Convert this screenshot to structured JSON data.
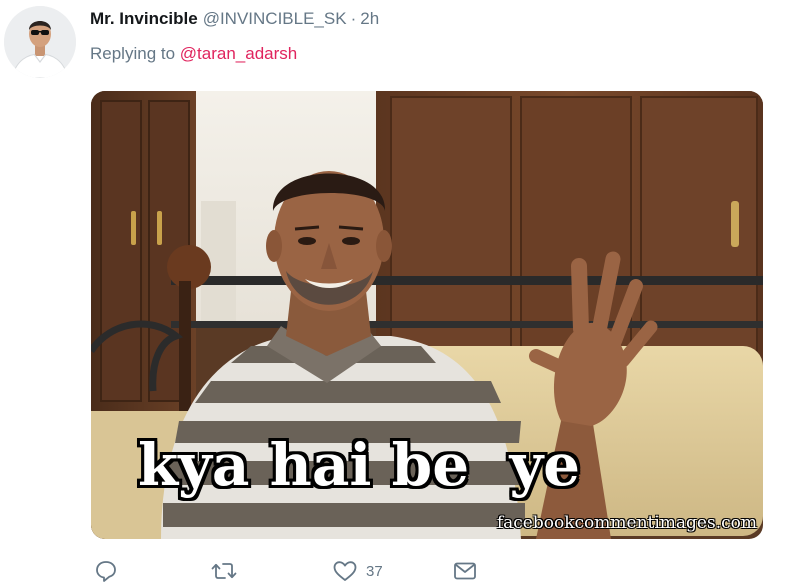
{
  "tweet": {
    "author": {
      "display_name": "Mr. Invincible",
      "handle": "@INVINCIBLE_SK",
      "separator": "·",
      "time": "2h"
    },
    "reply": {
      "prefix": "Replying to",
      "mention": "@taran_adarsh"
    },
    "media": {
      "caption": "kya hai be  ye",
      "watermark": "facebookcommentimages.com"
    },
    "actions": {
      "reply": {
        "icon": "reply-icon",
        "count": ""
      },
      "retweet": {
        "icon": "retweet-icon",
        "count": ""
      },
      "like": {
        "icon": "heart-icon",
        "count": "37"
      },
      "dm": {
        "icon": "envelope-icon",
        "count": ""
      }
    }
  },
  "colors": {
    "text_primary": "#14171a",
    "text_secondary": "#657786",
    "mention": "#e0245e"
  }
}
